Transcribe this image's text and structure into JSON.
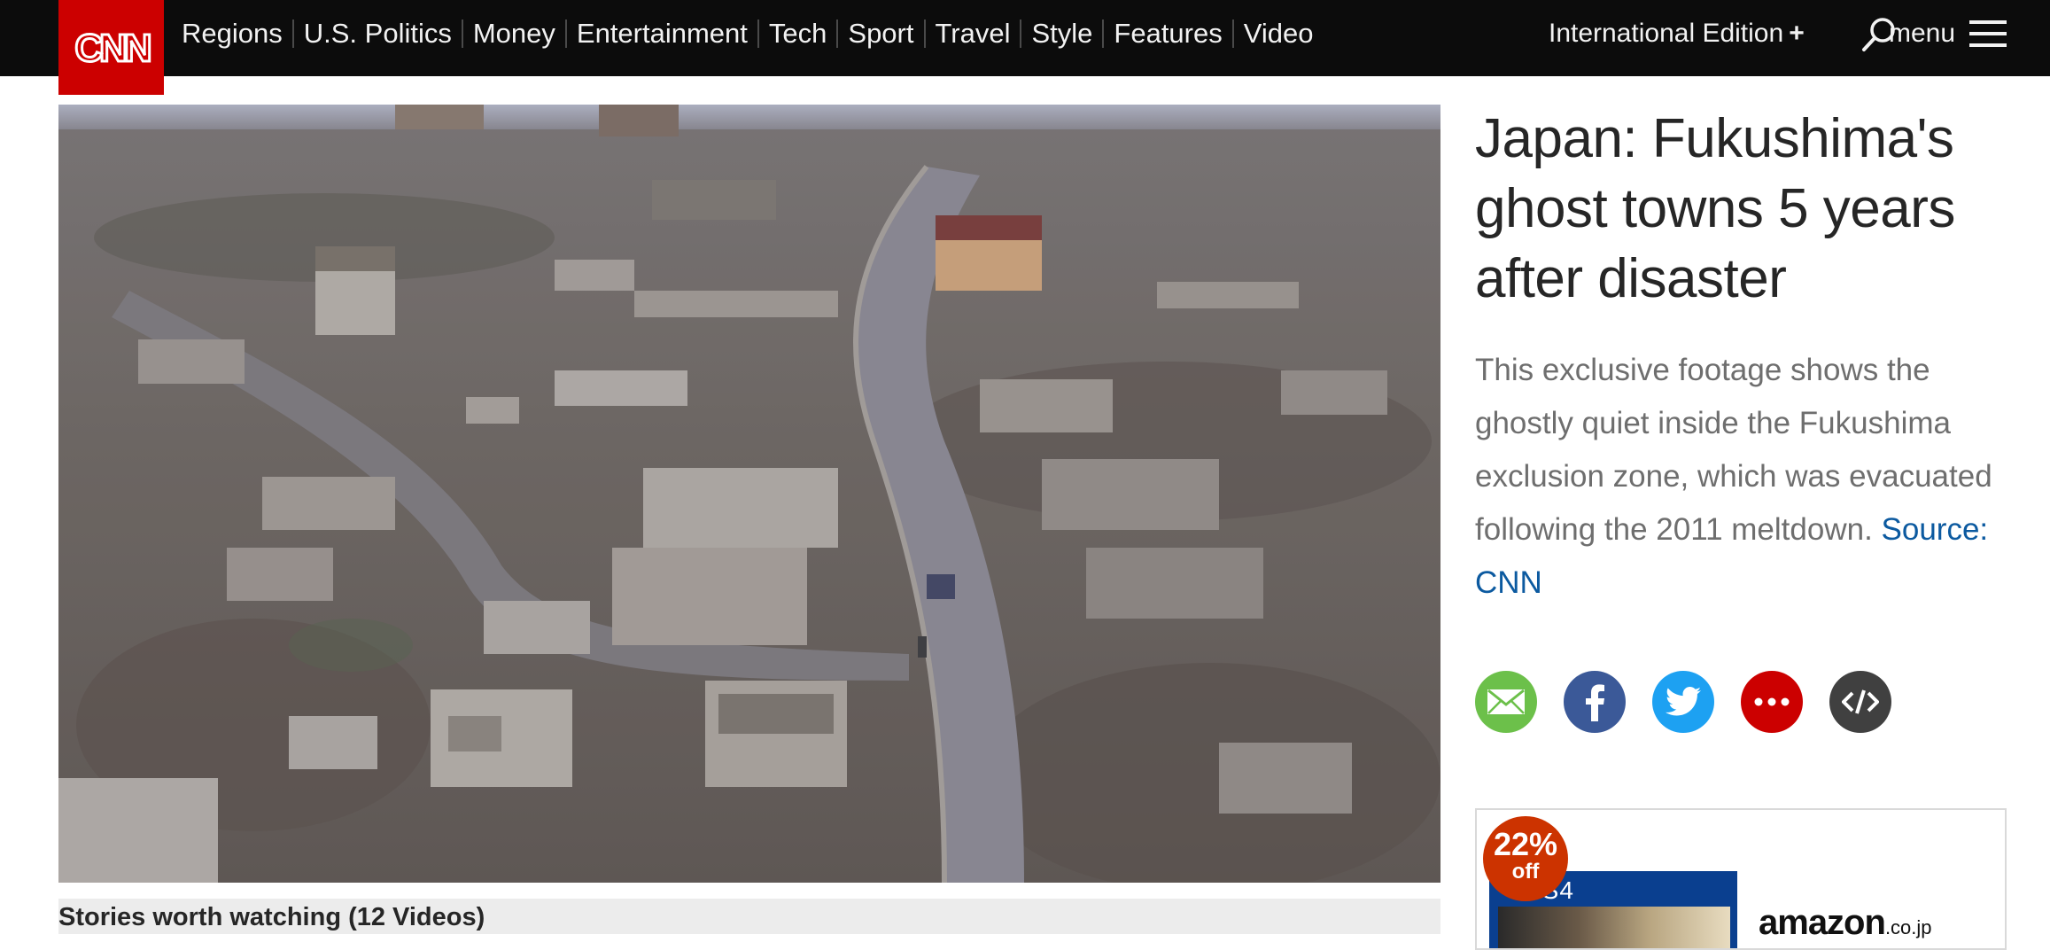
{
  "header": {
    "logo_text": "CNN",
    "nav_items": [
      {
        "label": "Regions"
      },
      {
        "label": "U.S. Politics"
      },
      {
        "label": "Money"
      },
      {
        "label": "Entertainment"
      },
      {
        "label": "Tech"
      },
      {
        "label": "Sport"
      },
      {
        "label": "Travel"
      },
      {
        "label": "Style"
      },
      {
        "label": "Features"
      },
      {
        "label": "Video"
      }
    ],
    "edition_label": "International Edition",
    "edition_plus": "+",
    "search_icon": "search-icon",
    "menu_label": "menu",
    "menu_icon": "hamburger-icon"
  },
  "video": {
    "thumbnail_icon": "aerial-landscape-thumbnail",
    "playlist_title": "Stories worth watching (12 Videos)"
  },
  "article": {
    "headline": "Japan: Fukushima's ghost towns 5 years after disaster",
    "description": "This exclusive footage shows the ghostly quiet inside the Fukushima exclusion zone, which was evacuated following the 2011 meltdown.",
    "source_link": "Source: CNN"
  },
  "share": [
    {
      "name": "email",
      "icon": "email-icon",
      "color": "#6cc04a"
    },
    {
      "name": "facebook",
      "icon": "facebook-icon",
      "color": "#3b5998"
    },
    {
      "name": "twitter",
      "icon": "twitter-icon",
      "color": "#1da1f2"
    },
    {
      "name": "more",
      "icon": "more-icon",
      "color": "#cc0000"
    },
    {
      "name": "embed",
      "icon": "embed-icon",
      "color": "#404040"
    }
  ],
  "ad": {
    "discount_pct": "22%",
    "discount_off": "off",
    "product_label": "PS4",
    "brand": "amazon",
    "brand_tld": ".co.jp"
  },
  "colors": {
    "brand_red": "#cc0000",
    "nav_bg": "#0c0c0c",
    "link_blue": "#0c5aa0"
  }
}
